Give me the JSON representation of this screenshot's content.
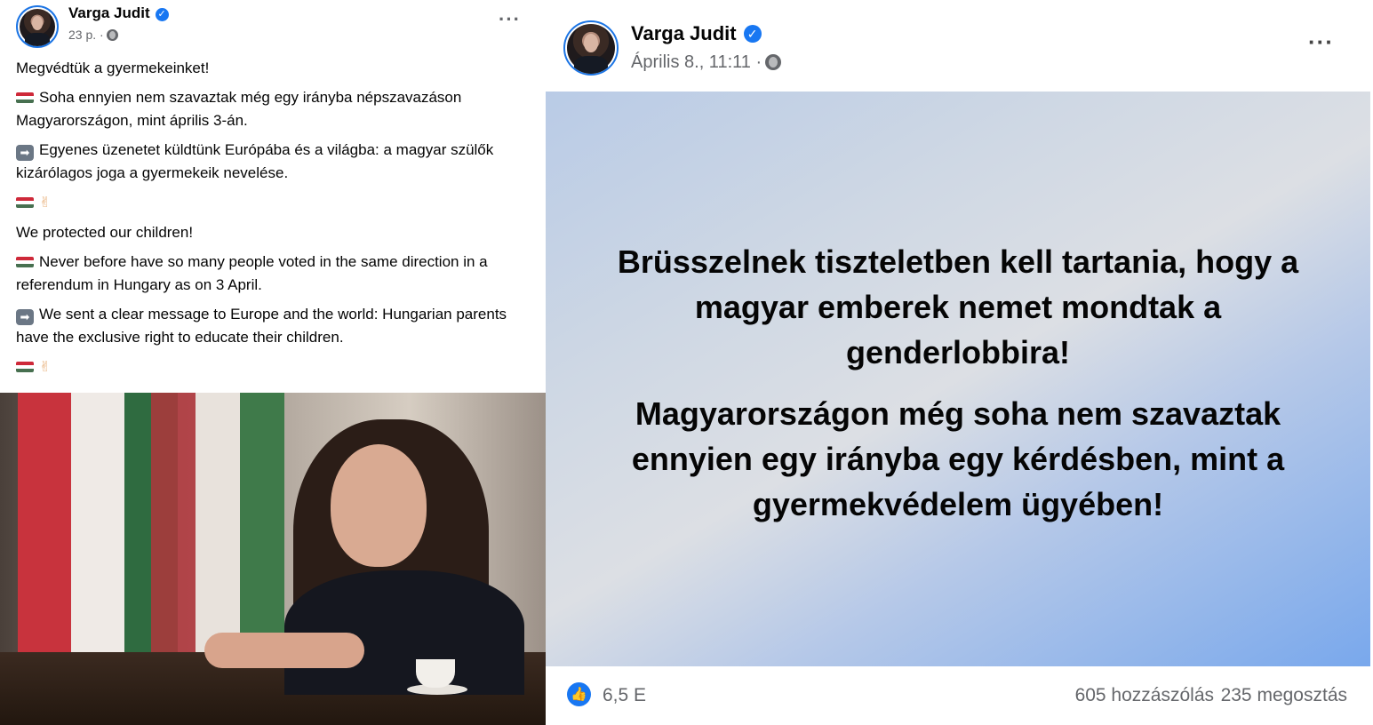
{
  "left_post": {
    "author": "Varga Judit",
    "time": "23 p. ·",
    "more_label": "···",
    "paragraphs": {
      "p1": "Megvédtük a gyermekeinket!",
      "p2": "Soha ennyien nem szavaztak még egy irányba népszavazáson Magyarországon, mint április 3-án.",
      "p3": "Egyenes üzenetet küldtünk Európába és a világba: a magyar szülők kizárólagos joga a gyermekeik nevelése.",
      "p5": "We protected our children!",
      "p6": "Never before have so many people voted in the same direction in a referendum in Hungary as on 3 April.",
      "p7": "We sent a clear message to Europe and the world: Hungarian parents have the exclusive right to educate their children."
    },
    "arrow_glyph": "➡",
    "peace_glyph": "✌"
  },
  "right_post": {
    "author": "Varga Judit",
    "time": "Április 8., 11:11 ·",
    "more_label": "···",
    "banner_text_1": "Brüsszelnek tiszteletben kell tartania, hogy a magyar emberek nemet mondtak a genderlobbira!",
    "banner_text_2": "Magyarországon még soha nem szavaztak ennyien egy irányba egy kérdésben, mint a gyermekvédelem ügyében!",
    "likes": "6,5 E",
    "comments": "605 hozzászólás",
    "shares": "235 megosztás"
  },
  "icons": {
    "verified": "verified-badge-icon",
    "globe": "globe-icon",
    "like": "like-icon",
    "flag": "hungarian-flag-icon",
    "arrow": "right-arrow-icon",
    "peace": "victory-hand-icon"
  },
  "colors": {
    "brand_blue": "#1877f2",
    "secondary_text": "#65676b",
    "flag_red": "#ce2939",
    "flag_white": "#ffffff",
    "flag_green": "#477050"
  }
}
